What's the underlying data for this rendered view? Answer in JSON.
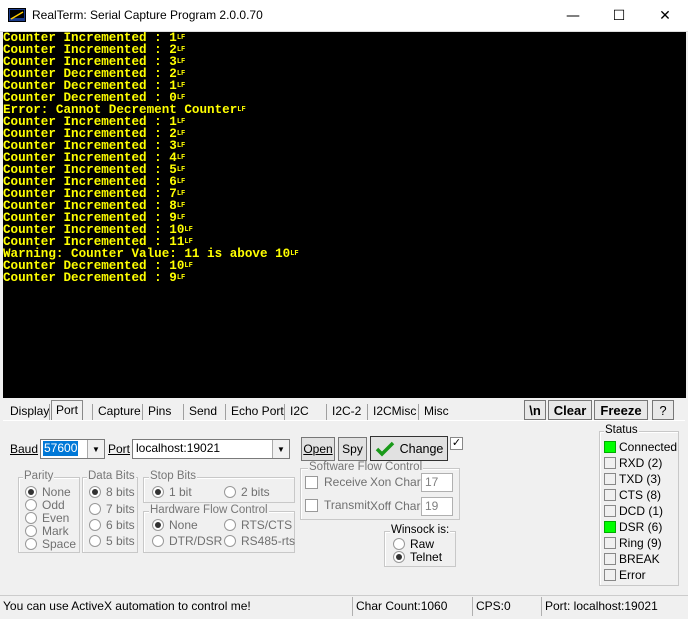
{
  "window": {
    "title": "RealTerm: Serial Capture Program 2.0.0.70",
    "minimize": "—",
    "maximize": "☐",
    "close": "✕"
  },
  "terminal": {
    "lines": [
      "Counter Incremented : 1",
      "Counter Incremented : 2",
      "Counter Incremented : 3",
      "Counter Decremented : 2",
      "Counter Decremented : 1",
      "Counter Decremented : 0",
      "Error: Cannot Decrement Counter",
      "Counter Incremented : 1",
      "Counter Incremented : 2",
      "Counter Incremented : 3",
      "Counter Incremented : 4",
      "Counter Incremented : 5",
      "Counter Incremented : 6",
      "Counter Incremented : 7",
      "Counter Incremented : 8",
      "Counter Incremented : 9",
      "Counter Incremented : 10",
      "Counter Incremented : 11",
      "Warning: Counter Value: 11 is above 10",
      "Counter Decremented : 10",
      "Counter Decremented : 9"
    ],
    "line_end_glyph": "LF"
  },
  "tabs": [
    "Display",
    "Port",
    "Capture",
    "Pins",
    "Send",
    "Echo Port",
    "I2C",
    "I2C-2",
    "I2CMisc",
    "Misc"
  ],
  "active_tab": "Port",
  "toolbar": {
    "newline": "\\n",
    "clear": "Clear",
    "freeze": "Freeze",
    "help": "?"
  },
  "port": {
    "baud_label": "Baud",
    "baud_value": "57600",
    "port_label": "Port",
    "port_value": "localhost:19021",
    "open_label": "Open",
    "spy_label": "Spy",
    "change_label": "Change"
  },
  "parity": {
    "legend": "Parity",
    "options": [
      "None",
      "Odd",
      "Even",
      "Mark",
      "Space"
    ],
    "selected": "None"
  },
  "data_bits": {
    "legend": "Data Bits",
    "options": [
      "8 bits",
      "7 bits",
      "6 bits",
      "5 bits"
    ],
    "selected": "8 bits"
  },
  "stop_bits": {
    "legend": "Stop Bits",
    "options": [
      "1 bit",
      "2 bits"
    ],
    "selected": "1 bit"
  },
  "hw_flow": {
    "legend": "Hardware Flow Control",
    "options": [
      "None",
      "RTS/CTS",
      "DTR/DSR",
      "RS485-rts"
    ],
    "selected": "None"
  },
  "sw_flow": {
    "legend": "Software Flow Control",
    "receive_label": "Receive",
    "transmit_label": "Transmit",
    "xon_label": "Xon Char:",
    "xon_value": "17",
    "xoff_label": "Xoff Char:",
    "xoff_value": "19"
  },
  "winsock": {
    "legend": "Winsock is:",
    "options": [
      "Raw",
      "Telnet"
    ],
    "selected": "Telnet"
  },
  "status": {
    "legend": "Status",
    "items": [
      {
        "label": "Connected",
        "on": true
      },
      {
        "label": "RXD (2)",
        "on": false
      },
      {
        "label": "TXD (3)",
        "on": false
      },
      {
        "label": "CTS (8)",
        "on": false
      },
      {
        "label": "DCD (1)",
        "on": false
      },
      {
        "label": "DSR (6)",
        "on": true
      },
      {
        "label": "Ring (9)",
        "on": false
      },
      {
        "label": "BREAK",
        "on": false
      },
      {
        "label": "Error",
        "on": false
      }
    ]
  },
  "statusbar": {
    "message": "You can use ActiveX automation to control me!",
    "char_count": "Char Count:1060",
    "cps": "CPS:0",
    "port": "Port: localhost:19021"
  },
  "colors": {
    "terminal_bg": "#000000",
    "terminal_text": "#ffff00",
    "led_on": "#00ff00",
    "selection": "#0078d7"
  }
}
